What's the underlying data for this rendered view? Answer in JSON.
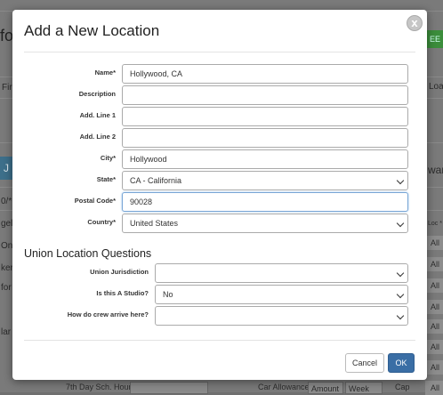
{
  "background": {
    "page_title_fragment": "fo",
    "add_button_fragment": "EE",
    "left_column_fragments": [
      "Fir",
      "J",
      "0/*",
      "gel",
      "On",
      "ker",
      "for",
      "lar"
    ],
    "right_column_fragments": [
      "Loa",
      "wan",
      "Loc *"
    ],
    "right_cells": [
      "All",
      "All",
      "All",
      "All",
      "All",
      "All",
      "All",
      "All",
      "All"
    ],
    "footer": {
      "hours_label": "7th Day Sch. Hours",
      "car_allowance_label": "Car Allowance",
      "amount_placeholder": "Amount",
      "period_value": "Week",
      "cap_label": "Cap",
      "cap_value": "All"
    }
  },
  "modal": {
    "title": "Add a New Location",
    "close_symbol": "x",
    "fields": {
      "name": {
        "label": "Name*",
        "value": "Hollywood, CA"
      },
      "description": {
        "label": "Description",
        "value": ""
      },
      "add_line_1": {
        "label": "Add. Line 1",
        "value": ""
      },
      "add_line_2": {
        "label": "Add. Line 2",
        "value": ""
      },
      "city": {
        "label": "City*",
        "value": "Hollywood"
      },
      "state": {
        "label": "State*",
        "value": "CA - California"
      },
      "postal_code": {
        "label": "Postal Code*",
        "value": "90028"
      },
      "country": {
        "label": "Country*",
        "value": "United States"
      }
    },
    "union_section": {
      "title": "Union Location Questions",
      "jurisdiction": {
        "label": "Union Jurisdiction",
        "value": ""
      },
      "studio": {
        "label": "Is this A Studio?",
        "value": "No"
      },
      "arrival": {
        "label": "How do crew arrive here?",
        "value": ""
      }
    },
    "buttons": {
      "cancel": "Cancel",
      "ok": "OK"
    }
  }
}
